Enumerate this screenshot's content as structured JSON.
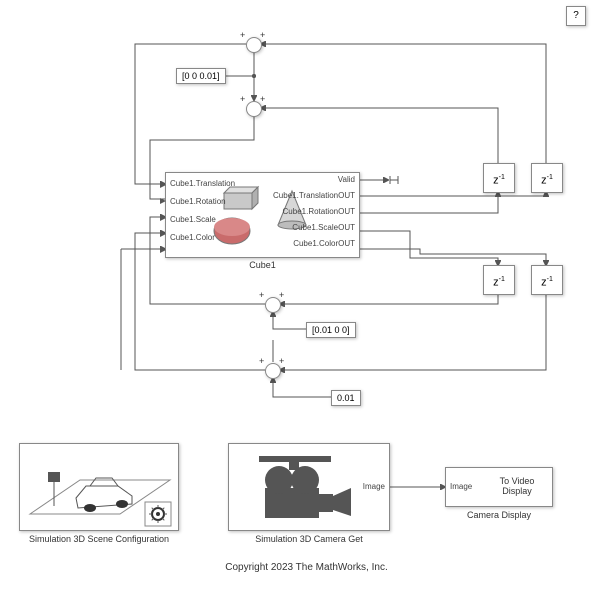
{
  "blocks": {
    "help": "?",
    "cube1": {
      "name": "Cube1",
      "ports_in": [
        "Cube1.Translation",
        "Cube1.Rotation",
        "Cube1.Scale",
        "Cube1.Color"
      ],
      "ports_out": [
        "Valid",
        "Cube1.TranslationOUT",
        "Cube1.RotationOUT",
        "Cube1.ScaleOUT",
        "Cube1.ColorOUT"
      ]
    },
    "const1": "[0 0 0.01]",
    "const2": "[0.01 0 0]",
    "const3": "0.01",
    "delay": "z",
    "delay_sup": "-1",
    "scene_config": "Simulation 3D Scene Configuration",
    "camera_get": "Simulation 3D Camera Get",
    "camera_display": "Camera Display",
    "camera_port_out": "Image",
    "camera_port_in": "Image",
    "video_display": "To Video Display"
  },
  "copyright": "Copyright 2023 The MathWorks, Inc."
}
